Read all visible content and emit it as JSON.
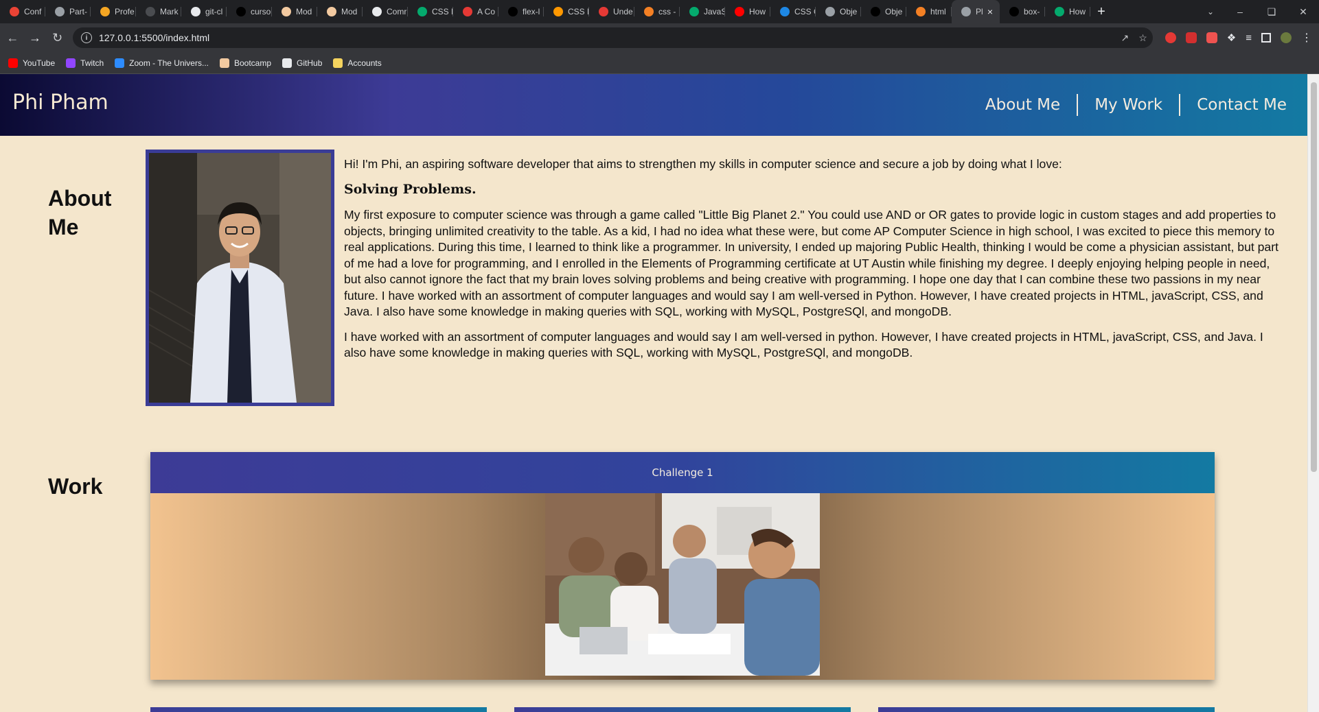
{
  "browser": {
    "tabs": [
      {
        "label": "Conf",
        "icon": "gmail-icon",
        "color": "#ea4335"
      },
      {
        "label": "Part-",
        "icon": "globe-icon",
        "color": "#9aa0a6"
      },
      {
        "label": "Profe",
        "icon": "ps-icon",
        "color": "#f5a623"
      },
      {
        "label": "Mark",
        "icon": "blank-icon",
        "color": "#4a4c50"
      },
      {
        "label": "git-cl",
        "icon": "github-icon",
        "color": "#e8eaed"
      },
      {
        "label": "curso",
        "icon": "mdn-icon",
        "color": "#000000"
      },
      {
        "label": "Mod",
        "icon": "bootcamp-icon",
        "color": "#f2c9a0"
      },
      {
        "label": "Mod",
        "icon": "bootcamp-icon",
        "color": "#f2c9a0"
      },
      {
        "label": "Comr",
        "icon": "github-icon",
        "color": "#e8eaed"
      },
      {
        "label": "CSS F",
        "icon": "w3-icon",
        "color": "#04aa6d"
      },
      {
        "label": "A Co",
        "icon": "star-icon",
        "color": "#e53935"
      },
      {
        "label": "flex-l",
        "icon": "mdn-icon",
        "color": "#000000"
      },
      {
        "label": "CSS F",
        "icon": "css-icon",
        "color": "#ff9800"
      },
      {
        "label": "Unde",
        "icon": "star-icon",
        "color": "#e53935"
      },
      {
        "label": "css -",
        "icon": "so-icon",
        "color": "#f48024"
      },
      {
        "label": "JavaS",
        "icon": "w3-icon",
        "color": "#04aa6d"
      },
      {
        "label": "How",
        "icon": "youtube-icon",
        "color": "#ff0000"
      },
      {
        "label": "CSS C",
        "icon": "edge-icon",
        "color": "#1e88e5"
      },
      {
        "label": "Obje",
        "icon": "globe-icon",
        "color": "#9aa0a6"
      },
      {
        "label": "Obje",
        "icon": "mdn-icon",
        "color": "#000000"
      },
      {
        "label": "html",
        "icon": "so-icon",
        "color": "#f48024"
      },
      {
        "label": "Pl",
        "icon": "globe-icon",
        "color": "#9aa0a6",
        "active": true
      },
      {
        "label": "box-",
        "icon": "mdn-icon",
        "color": "#000000"
      },
      {
        "label": "How",
        "icon": "w3-icon",
        "color": "#04aa6d"
      }
    ],
    "url": "127.0.0.1:5500/index.html",
    "bookmarks": [
      {
        "label": "YouTube",
        "icon": "youtube-icon",
        "color": "#ff0000"
      },
      {
        "label": "Twitch",
        "icon": "twitch-icon",
        "color": "#9146ff"
      },
      {
        "label": "Zoom - The Univers...",
        "icon": "zoom-icon",
        "color": "#2d8cff"
      },
      {
        "label": "Bootcamp",
        "icon": "bootcamp-icon",
        "color": "#f2c9a0"
      },
      {
        "label": "GitHub",
        "icon": "github-icon",
        "color": "#e8eaed"
      },
      {
        "label": "Accounts",
        "icon": "folder-icon",
        "color": "#f4d35e"
      }
    ]
  },
  "site": {
    "name": "Phi Pham",
    "nav": [
      "About Me",
      "My Work",
      "Contact Me"
    ],
    "about": {
      "title": "About Me",
      "intro": "Hi! I'm Phi, an aspiring software developer that aims to strengthen my skills in computer science and secure a job by doing what I love:",
      "subheading": "Solving Problems.",
      "paragraph1": "My first exposure to computer science was through a game called \"Little Big Planet 2.\" You could use AND or OR gates to provide logic in custom stages and add properties to objects, bringing unlimited creativity to the table. As a kid, I had no idea what these were, but come AP Computer Science in high school, I was excited to piece this memory to real applications. During this time, I learned to think like a programmer. In university, I ended up majoring Public Health, thinking I would be come a physician assistant, but part of me had a love for programming, and I enrolled in the Elements of Programming certificate at UT Austin while finishing my degree. I deeply enjoying helping people in need, but also cannot ignore the fact that my brain loves solving problems and being creative with programming. I hope one day that I can combine these two passions in my near future. I have worked with an assortment of computer languages and would say I am well-versed in Python. However, I have created projects in HTML, javaScript, CSS, and Java. I also have some knowledge in making queries with SQL, working with MySQL, PostgreSQl, and mongoDB.",
      "paragraph2": "I have worked with an assortment of computer languages and would say I am well-versed in python. However, I have created projects in HTML, javaScript, CSS, and Java. I also have some knowledge in making queries with SQL, working with MySQL, PostgreSQl, and mongoDB."
    },
    "work": {
      "title": "Work",
      "featured_label": "Challenge 1"
    }
  }
}
